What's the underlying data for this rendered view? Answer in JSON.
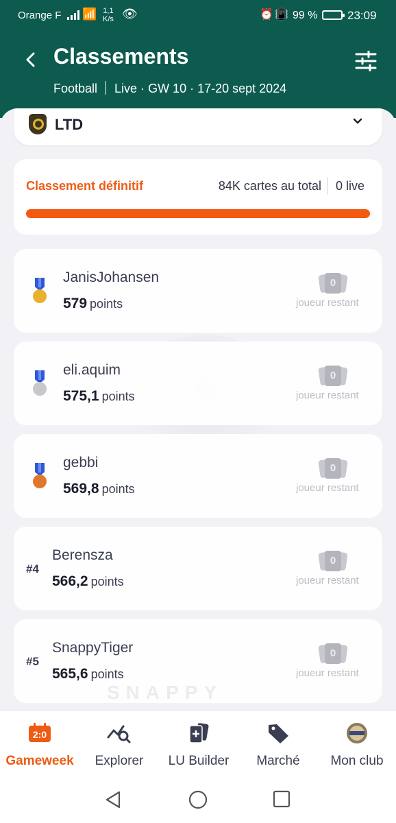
{
  "status_bar": {
    "carrier": "Orange F",
    "speed_value": "1,1",
    "speed_unit": "K/s",
    "battery": "99 %",
    "time": "23:09",
    "icons": [
      "signal-icon",
      "wifi-icon",
      "eye-icon",
      "alarm-icon",
      "vibrate-icon",
      "battery-saver-icon"
    ]
  },
  "header": {
    "title": "Classements",
    "sport": "Football",
    "context": "Live · GW 10 · 17-20 sept 2024"
  },
  "league_selector": {
    "label": "LTD"
  },
  "stats": {
    "status_label": "Classement définitif",
    "total_cards": "84K cartes au total",
    "live_count": "0 live",
    "progress": 1.0,
    "accent_color": "#f25a12"
  },
  "rankings": [
    {
      "rank": 1,
      "rank_label": "",
      "medal": "gold",
      "name": "JanisJohansen",
      "points": "579",
      "points_label": "points",
      "remaining": "0",
      "remaining_label": "joueur restant"
    },
    {
      "rank": 2,
      "rank_label": "",
      "medal": "silver",
      "name": "eli.aquim",
      "points": "575,1",
      "points_label": "points",
      "remaining": "0",
      "remaining_label": "joueur restant"
    },
    {
      "rank": 3,
      "rank_label": "",
      "medal": "bronze",
      "name": "gebbi",
      "points": "569,8",
      "points_label": "points",
      "remaining": "0",
      "remaining_label": "joueur restant"
    },
    {
      "rank": 4,
      "rank_label": "#4",
      "medal": "",
      "name": "Berensza",
      "points": "566,2",
      "points_label": "points",
      "remaining": "0",
      "remaining_label": "joueur restant"
    },
    {
      "rank": 5,
      "rank_label": "#5",
      "medal": "",
      "name": "SnappyTiger",
      "points": "565,6",
      "points_label": "points",
      "remaining": "0",
      "remaining_label": "joueur restant"
    }
  ],
  "watermark": {
    "text": "SNAPPY"
  },
  "tabs": [
    {
      "label": "Gameweek",
      "icon": "scoreboard-icon",
      "active": true
    },
    {
      "label": "Explorer",
      "icon": "chart-search-icon",
      "active": false
    },
    {
      "label": "LU Builder",
      "icon": "cards-plus-icon",
      "active": false
    },
    {
      "label": "Marché",
      "icon": "tag-icon",
      "active": false
    },
    {
      "label": "Mon club",
      "icon": "club-avatar-icon",
      "active": false
    }
  ],
  "colors": {
    "header_bg": "#0d5b4f",
    "accent": "#ef5a14",
    "background": "#f2f2f6",
    "medal_gold": "#e8b22e",
    "medal_silver": "#c7c7cc",
    "medal_bronze": "#e0782c"
  }
}
